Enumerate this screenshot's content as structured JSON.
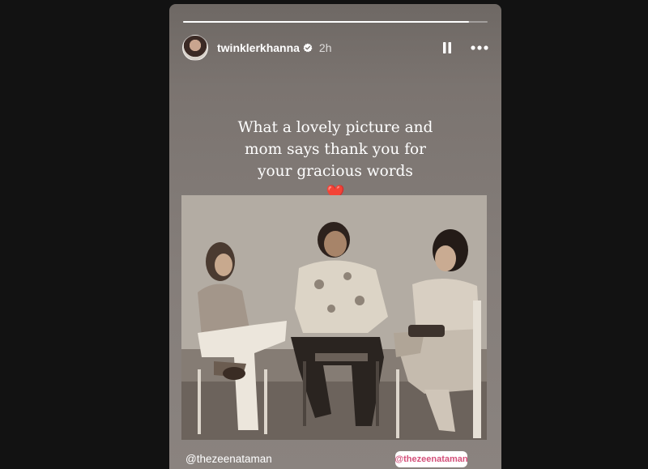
{
  "story": {
    "progress": 0.94,
    "user": {
      "username": "twinklerkhanna",
      "verified": true,
      "timestamp": "2h"
    },
    "controls": {
      "pause_icon": "pause-icon",
      "more_icon": "more-options-icon"
    },
    "caption": {
      "line1": "What a lovely picture and",
      "line2": "mom says thank you for",
      "line3": "your gracious words",
      "emoji": "❤️"
    },
    "mention_text": "@thezeenataman",
    "mention_sticker": "@thezeenataman"
  },
  "colors": {
    "background": "#121212",
    "story_bg": "#7b7470",
    "mention_sticker_text": "#d4507a",
    "heart": "#e0302e"
  }
}
